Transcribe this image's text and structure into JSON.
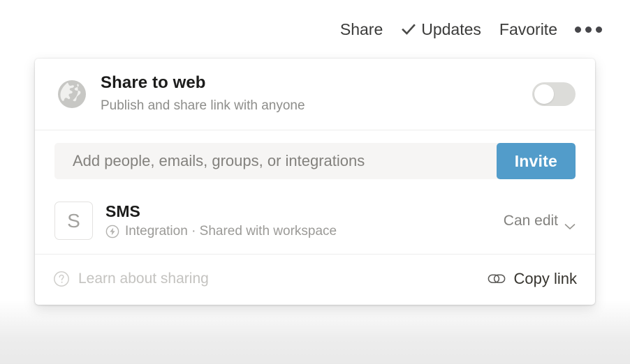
{
  "topbar": {
    "share_label": "Share",
    "updates_label": "Updates",
    "updates_icon": "check-icon",
    "favorite_label": "Favorite",
    "more_icon": "ellipsis-icon"
  },
  "share_panel": {
    "web": {
      "icon": "globe-icon",
      "title": "Share to web",
      "subtitle": "Publish and share link with anyone",
      "toggle_state": "off"
    },
    "invite": {
      "placeholder": "Add people, emails, groups, or integrations",
      "value": "",
      "button_label": "Invite",
      "button_color": "#529cca"
    },
    "members": [
      {
        "avatar_initial": "S",
        "name": "SMS",
        "type_icon": "bolt-icon",
        "meta": "Integration · Shared with workspace",
        "permission": "Can edit",
        "permission_icon": "chevron-down-icon"
      }
    ],
    "footer": {
      "help_icon": "question-circle-icon",
      "help_label": "Learn about sharing",
      "copy_icon": "link-icon",
      "copy_label": "Copy link"
    }
  }
}
